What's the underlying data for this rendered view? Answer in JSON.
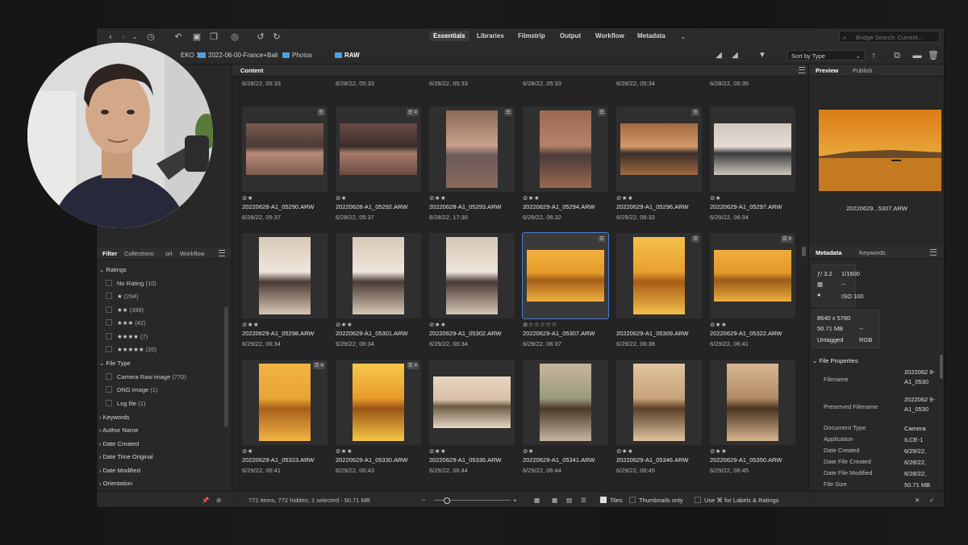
{
  "toolbar": {
    "workspaces": [
      "Essentials",
      "Libraries",
      "Filmstrip",
      "Output",
      "Workflow",
      "Metadata"
    ],
    "active_workspace": "Essentials",
    "search_placeholder": "Bridge Search: Current..."
  },
  "pathbar": {
    "crumbs": [
      "EKO 1-1",
      "2022-06-00-France+Bali",
      "Photos",
      "RAW"
    ],
    "sort_label": "Sort by Type"
  },
  "filter_panel": {
    "tabs": [
      "Filter",
      "Collections",
      "ort",
      "Workflow"
    ],
    "active_tab": "Filter",
    "ratings_title": "Ratings",
    "ratings": [
      {
        "label": "No Rating",
        "count": "(10)"
      },
      {
        "label": "★",
        "count": "(294)"
      },
      {
        "label": "★★",
        "count": "(399)"
      },
      {
        "label": "★★★",
        "count": "(42)"
      },
      {
        "label": "★★★★",
        "count": "(7)"
      },
      {
        "label": "★★★★★",
        "count": "(20)"
      }
    ],
    "filetype_title": "File Type",
    "filetypes": [
      {
        "label": "Camera Raw image",
        "count": "(770)"
      },
      {
        "label": "DNG image",
        "count": "(1)"
      },
      {
        "label": "Log file",
        "count": "(1)"
      }
    ],
    "sections": [
      "Keywords",
      "Author Name",
      "Date Created",
      "Date Time Original",
      "Date Modified",
      "Orientation"
    ]
  },
  "content": {
    "title": "Content",
    "top_row_dates": [
      "6/28/22, 05:33",
      "6/28/22, 05:33",
      "6/28/22, 05:33",
      "6/28/22, 05:33",
      "6/28/22, 05:34",
      "6/28/22, 05:35"
    ],
    "items": [
      {
        "stars": "⊘★",
        "name": "20220628-A1_05290.ARW",
        "date": "6/28/22, 05:37"
      },
      {
        "stars": "⊘★",
        "name": "20220628-A1_05292.ARW",
        "date": "6/28/22, 05:37"
      },
      {
        "stars": "⊘★★",
        "name": "20220628-A1_05293.ARW",
        "date": "6/28/22, 17:30"
      },
      {
        "stars": "⊘★★",
        "name": "20220629-A1_05294.ARW",
        "date": "6/29/22, 06:32"
      },
      {
        "stars": "⊘★★",
        "name": "20220629-A1_05296.ARW",
        "date": "6/29/22, 06:32"
      },
      {
        "stars": "⊘★",
        "name": "20220629-A1_05297.ARW",
        "date": "6/29/22, 06:34"
      },
      {
        "stars": "⊘★★",
        "name": "20220629-A1_05298.ARW",
        "date": "6/29/22, 06:34"
      },
      {
        "stars": "⊘★★",
        "name": "20220629-A1_05301.ARW",
        "date": "6/29/22, 06:34"
      },
      {
        "stars": "⊘★★",
        "name": "20220629-A1_05302.ARW",
        "date": "6/29/22, 06:34"
      },
      {
        "stars": "⊘☆☆☆☆☆",
        "name": "20220629-A1_05307.ARW",
        "date": "6/29/22, 06:37"
      },
      {
        "stars": "",
        "name": "20220629-A1_05309.ARW",
        "date": "6/29/22, 06:38"
      },
      {
        "stars": "⊘★★",
        "name": "20220629-A1_05322.ARW",
        "date": "6/29/22, 06:41"
      },
      {
        "stars": "⊘★",
        "name": "20220629-A1_05323.ARW",
        "date": "6/29/22, 06:41"
      },
      {
        "stars": "⊘★★",
        "name": "20220629-A1_05330.ARW",
        "date": "6/29/22, 06:43"
      },
      {
        "stars": "⊘★★",
        "name": "20220629-A1_05336.ARW",
        "date": "6/29/22, 06:44"
      },
      {
        "stars": "⊘★",
        "name": "20220629-A1_05341.ARW",
        "date": "6/29/22, 06:44"
      },
      {
        "stars": "⊘★★",
        "name": "20220629-A1_05346.ARW",
        "date": "6/29/22, 06:45"
      },
      {
        "stars": "⊘★★",
        "name": "20220629-A1_05350.ARW",
        "date": "6/29/22, 06:45"
      }
    ]
  },
  "statusbar": {
    "summary": "772 items, 772 hidden, 1 selected - 50.71 MB",
    "tiles_label": "Tiles",
    "thumbs_only_label": "Thumbnails only",
    "use_cmd_label": "Use ⌘ for Labels & Ratings"
  },
  "preview": {
    "tabs": [
      "Preview",
      "Publish"
    ],
    "active_tab": "Preview",
    "caption": "20220629...5307.ARW"
  },
  "metadata": {
    "tabs": [
      "Metadata",
      "Keywords"
    ],
    "active_tab": "Metadata",
    "aperture": "ƒ/ 3.2",
    "shutter": "1/1600",
    "dash1": "--",
    "dash2": "--",
    "iso": "ISO 100",
    "dimensions": "8640 x 5760",
    "size": "50.71 MB",
    "size_dash": "--",
    "profile": "Untagged",
    "colormode": "RGB",
    "section_title": "File Properties",
    "rows": [
      {
        "label": "Filename",
        "value": "2022062 9-A1_0530"
      },
      {
        "label": "Preserved Filename",
        "value": "2022062 9-A1_0530"
      },
      {
        "label": "Document Type",
        "value": "Camera"
      },
      {
        "label": "Application",
        "value": "ILCE-1"
      },
      {
        "label": "Date Created",
        "value": "6/29/22,"
      },
      {
        "label": "Date File Created",
        "value": "6/28/22,"
      },
      {
        "label": "Date File Modified",
        "value": "6/28/22,"
      },
      {
        "label": "File Size",
        "value": "50.71 MB"
      }
    ]
  },
  "colors": {
    "accent": "#4a7fd6",
    "folder": "#4aa3e8",
    "app_bg": "#252525"
  }
}
